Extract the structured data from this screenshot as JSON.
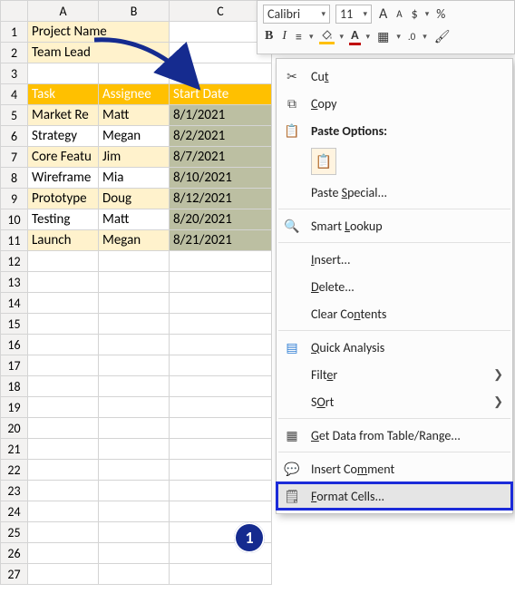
{
  "columns": [
    "A",
    "B",
    "C"
  ],
  "rows": [
    "1",
    "2",
    "3",
    "4",
    "5",
    "6",
    "7",
    "8",
    "9",
    "10",
    "11",
    "12",
    "13",
    "14",
    "15",
    "16",
    "17",
    "18",
    "19",
    "20",
    "21",
    "22",
    "23",
    "24",
    "25",
    "26",
    "27"
  ],
  "hdr1": "Project Name",
  "hdr2": "Team Lead",
  "table_headers": {
    "task": "Task",
    "assignee": "Assignee",
    "start": "Start Date"
  },
  "tasks": [
    {
      "task": "Market Re",
      "assignee": "Matt",
      "date": "8/1/2021"
    },
    {
      "task": "Strategy",
      "assignee": "Megan",
      "date": "8/2/2021"
    },
    {
      "task": "Core Featu",
      "assignee": "Jim",
      "date": "8/7/2021"
    },
    {
      "task": "Wireframe",
      "assignee": "Mia",
      "date": "8/10/2021"
    },
    {
      "task": "Prototype",
      "assignee": "Doug",
      "date": "8/12/2021"
    },
    {
      "task": "Testing",
      "assignee": "Matt",
      "date": "8/20/2021"
    },
    {
      "task": "Launch",
      "assignee": "Megan",
      "date": "8/21/2021"
    }
  ],
  "mini": {
    "font": "Calibri",
    "size": "11",
    "labels": {
      "bigA": "A",
      "smallA": "A",
      "dollar": "$",
      "percent": "%",
      "bold": "B",
      "italic": "I",
      "fontcolor": "A"
    }
  },
  "ctx": {
    "cut": "Cut",
    "copy": "Copy",
    "paste_opts": "Paste Options:",
    "paste_special": "Paste Special...",
    "smart_lookup": "Smart Lookup",
    "insert": "Insert...",
    "delete": "Delete...",
    "clear": "Clear Contents",
    "quick": "Quick Analysis",
    "filter": "Filter",
    "sort": "Sort",
    "get_data": "Get Data from Table/Range...",
    "comment": "Insert Comment",
    "format": "Format Cells..."
  },
  "mn": {
    "cut": "t",
    "copy": "C",
    "paste_special": "S",
    "smart": "L",
    "insert": "I",
    "delete": "D",
    "clear": "n",
    "quick": "Q",
    "filter": "e",
    "sort": "O",
    "get": "G",
    "comment": "m",
    "format": "F"
  },
  "callout": "1"
}
